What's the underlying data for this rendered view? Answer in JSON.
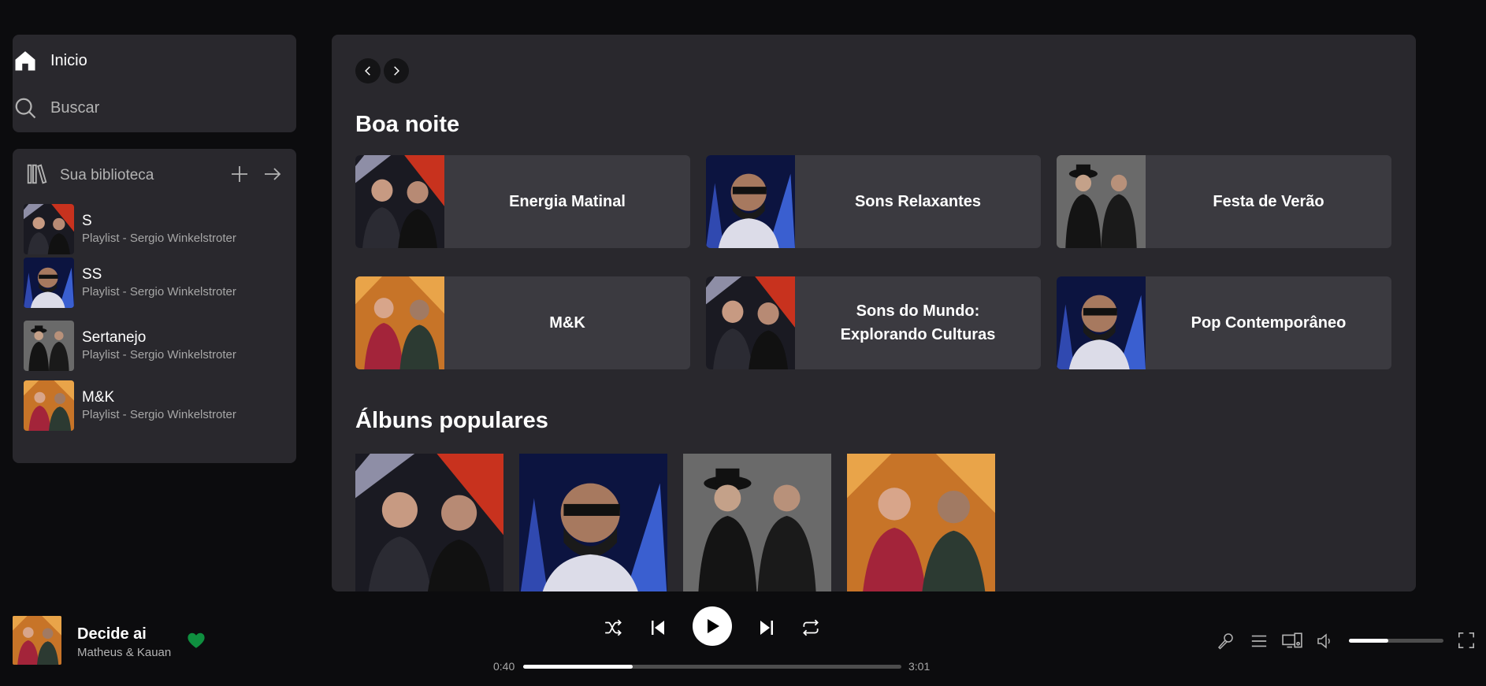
{
  "nav": {
    "home_label": "Inicio",
    "search_label": "Buscar"
  },
  "library": {
    "title": "Sua biblioteca",
    "items": [
      {
        "title": "S",
        "subtitle": "Playlist - Sergio Winkelstroter",
        "art": "duo-red"
      },
      {
        "title": "SS",
        "subtitle": "Playlist - Sergio Winkelstroter",
        "art": "singer-blue"
      },
      {
        "title": "Sertanejo",
        "subtitle": "Playlist - Sergio Winkelstroter",
        "art": "duo-gray"
      },
      {
        "title": "M&K",
        "subtitle": "Playlist - Sergio Winkelstroter",
        "art": "duo-gold"
      }
    ]
  },
  "main": {
    "greeting": "Boa noite",
    "cards": [
      {
        "title": "Energia Matinal",
        "art": "duo-red"
      },
      {
        "title": "Sons Relaxantes",
        "art": "singer-blue"
      },
      {
        "title": "Festa de Verão",
        "art": "duo-gray"
      },
      {
        "title": "M&K",
        "art": "duo-gold"
      },
      {
        "title": "Sons do Mundo: Explorando Culturas",
        "art": "duo-red"
      },
      {
        "title": "Pop Contemporâneo",
        "art": "singer-blue"
      }
    ],
    "albums_title": "Álbuns populares",
    "albums": [
      {
        "art": "duo-red"
      },
      {
        "art": "singer-blue"
      },
      {
        "art": "duo-gray"
      },
      {
        "art": "duo-gold"
      }
    ]
  },
  "player": {
    "song": "Decide ai",
    "artist": "Matheus & Kauan",
    "current_time": "0:40",
    "total_time": "3:01",
    "progress": 0.29,
    "volume": 0.42,
    "liked": true,
    "accent_color": "#1db954"
  }
}
